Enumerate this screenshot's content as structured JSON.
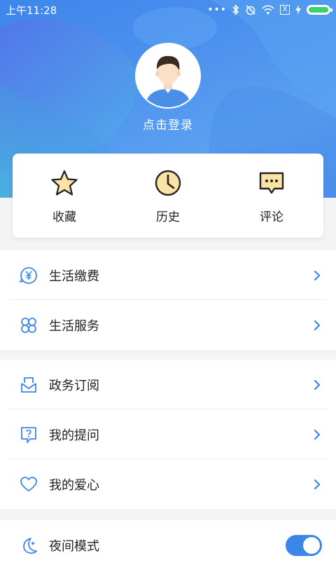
{
  "status_bar": {
    "time": "上午11:28",
    "dots": "•••",
    "sim_label": "X"
  },
  "profile": {
    "login_text": "点击登录"
  },
  "actions": [
    {
      "label": "收藏",
      "icon": "star-icon"
    },
    {
      "label": "历史",
      "icon": "clock-icon"
    },
    {
      "label": "评论",
      "icon": "comment-icon"
    }
  ],
  "group1": [
    {
      "label": "生活缴费",
      "icon": "yuan-bill-icon"
    },
    {
      "label": "生活服务",
      "icon": "clover-services-icon"
    }
  ],
  "group2": [
    {
      "label": "政务订阅",
      "icon": "inbox-subscribe-icon"
    },
    {
      "label": "我的提问",
      "icon": "question-bubble-icon"
    },
    {
      "label": "我的爱心",
      "icon": "heart-icon"
    }
  ],
  "group3": [
    {
      "label": "夜间模式",
      "icon": "moon-icon",
      "toggle_on": true
    }
  ],
  "colors": {
    "accent": "#3b86e8",
    "star_fill": "#fbe3a6",
    "text": "#222222"
  }
}
